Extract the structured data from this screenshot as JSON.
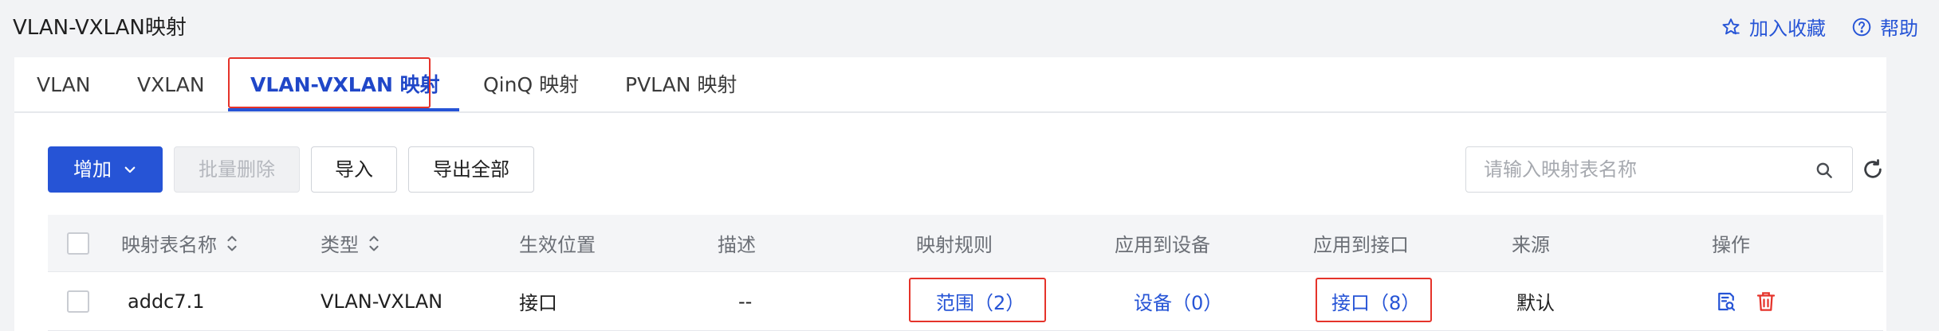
{
  "header": {
    "title": "VLAN-VXLAN映射",
    "favorite_label": "加入收藏",
    "help_label": "帮助"
  },
  "tabs": [
    {
      "label": "VLAN",
      "active": false
    },
    {
      "label": "VXLAN",
      "active": false
    },
    {
      "label": "VLAN-VXLAN 映射",
      "active": true
    },
    {
      "label": "QinQ 映射",
      "active": false
    },
    {
      "label": "PVLAN 映射",
      "active": false
    }
  ],
  "toolbar": {
    "add_label": "增加",
    "batch_delete_label": "批量删除",
    "import_label": "导入",
    "export_all_label": "导出全部",
    "search_placeholder": "请输入映射表名称",
    "search_value": ""
  },
  "table": {
    "columns": [
      "映射表名称",
      "类型",
      "生效位置",
      "描述",
      "映射规则",
      "应用到设备",
      "应用到接口",
      "来源",
      "操作"
    ],
    "rows": [
      {
        "name": "addc7.1",
        "type": "VLAN-VXLAN",
        "location": "接口",
        "description": "--",
        "rules": "范围（2）",
        "devices": "设备（0）",
        "interfaces": "接口（8）",
        "source": "默认"
      }
    ]
  },
  "colors": {
    "accent": "#2654d6",
    "highlight_border": "#e5332a",
    "delete_icon": "#e5332a"
  }
}
